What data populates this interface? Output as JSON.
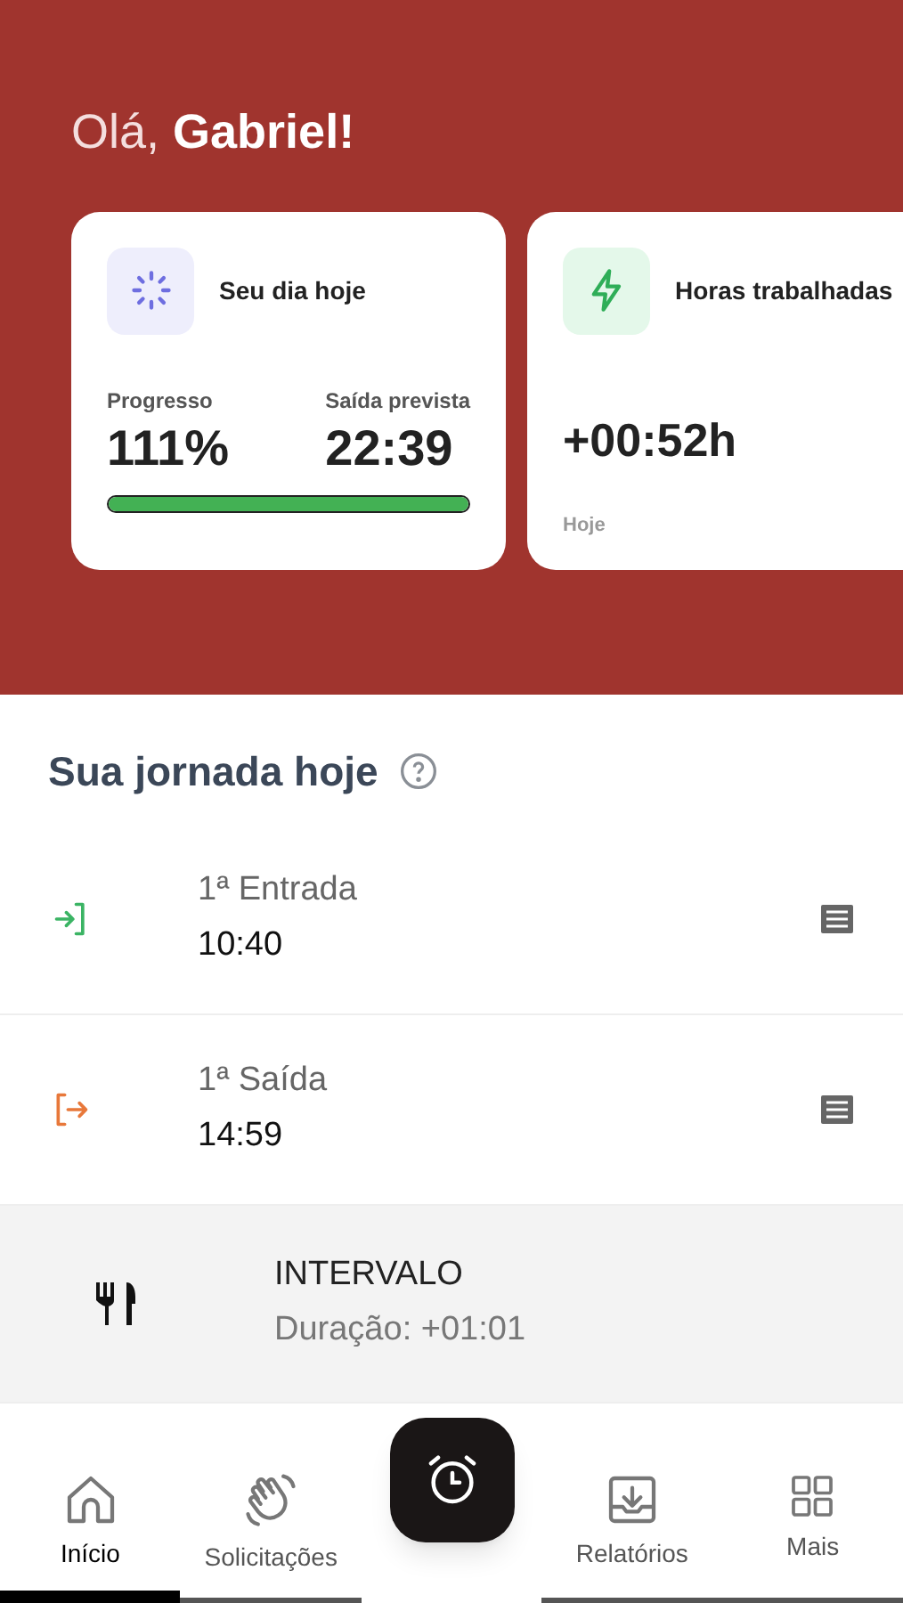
{
  "greeting": {
    "prefix": "Olá,",
    "name": "Gabriel!"
  },
  "cards": [
    {
      "kind": "progress",
      "title": "Seu dia hoje",
      "progress_label": "Progresso",
      "progress_value": "111%",
      "exit_label": "Saída prevista",
      "exit_value": "22:39",
      "level": 1
    },
    {
      "kind": "hours",
      "title": "Horas trabalhadas",
      "value": "+00:52h",
      "caption": "Hoje"
    }
  ],
  "journey": {
    "title": "Sua jornada hoje",
    "entries": [
      {
        "kind": "in",
        "label": "1ª Entrada",
        "time": "10:40"
      },
      {
        "kind": "out",
        "label": "1ª Saída",
        "time": "14:59"
      },
      {
        "kind": "break",
        "label": "INTERVALO",
        "time": "Duração: +01:01"
      }
    ]
  },
  "nav": [
    {
      "kind": "home",
      "label": "Início",
      "selected": true
    },
    {
      "kind": "wave",
      "label": "Solicitações",
      "selected": false
    },
    {
      "kind": "clock",
      "selected": false
    },
    {
      "kind": "download",
      "label": "Relatórios",
      "selected": false
    },
    {
      "kind": "grid",
      "label": "Mais",
      "selected": false
    }
  ]
}
